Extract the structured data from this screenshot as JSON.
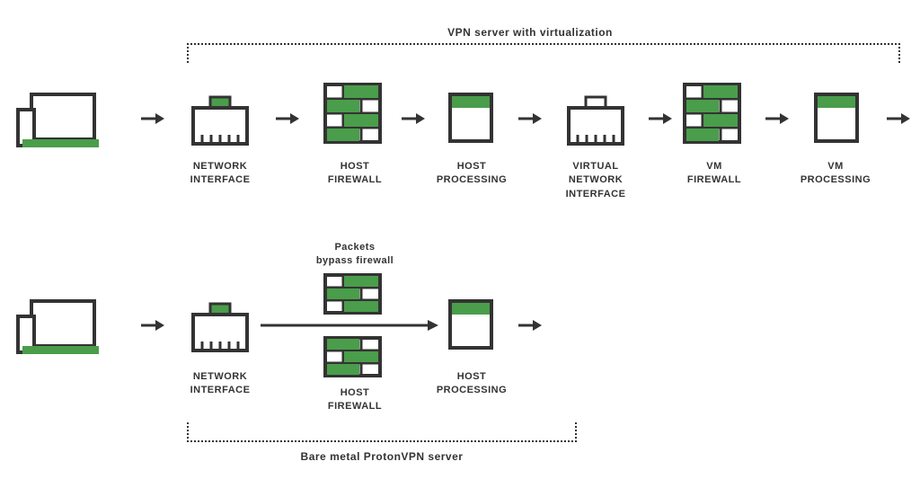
{
  "diagram": {
    "top_caption": "VPN server with virtualization",
    "bottom_caption": "Bare metal ProtonVPN server",
    "bypass_text": "Packets\nbypass firewall",
    "nodes": {
      "nic1": "NETWORK\nINTERFACE",
      "host_fw1": "HOST\nFIREWALL",
      "host_proc1": "HOST\nPROCESSING",
      "vnic": "VIRTUAL\nNETWORK\nINTERFACE",
      "vm_fw": "VM\nFIREWALL",
      "vm_proc": "VM\nPROCESSING",
      "nic2": "NETWORK\nINTERFACE",
      "host_fw2": "HOST\nFIREWALL",
      "host_proc2": "HOST\nPROCESSING"
    },
    "colors": {
      "accent": "#4a9d4a",
      "stroke": "#333333",
      "bg": "#ffffff"
    }
  }
}
